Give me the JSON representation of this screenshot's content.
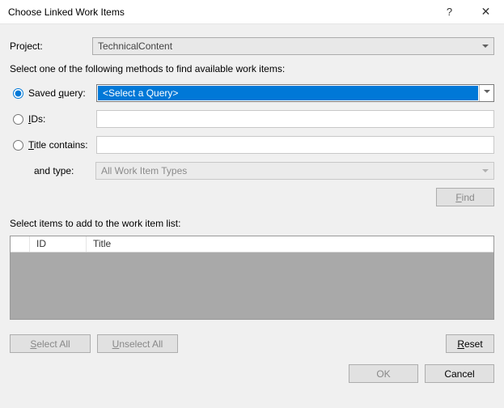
{
  "titlebar": {
    "title": "Choose Linked Work Items"
  },
  "labels": {
    "project": "Project:",
    "instruction": "Select one of the following methods to find available work items:",
    "saved_query_pre": "Saved ",
    "saved_query_u": "q",
    "saved_query_post": "uery:",
    "ids_u": "I",
    "ids_post": "Ds:",
    "title_u": "T",
    "title_post": "itle contains:",
    "and_type": "and type:",
    "find_u": "F",
    "find_post": "ind",
    "select_items": "Select items to add to the work item list:",
    "col_id": "ID",
    "col_title": "Title",
    "select_all_u": "S",
    "select_all_post": "elect All",
    "unselect_all_u": "U",
    "unselect_all_post": "nselect All",
    "reset_u": "R",
    "reset_post": "eset",
    "ok": "OK",
    "cancel": "Cancel"
  },
  "values": {
    "project": "TechnicalContent",
    "saved_query_selected": "<Select a Query>",
    "work_item_type": "All Work Item Types"
  }
}
